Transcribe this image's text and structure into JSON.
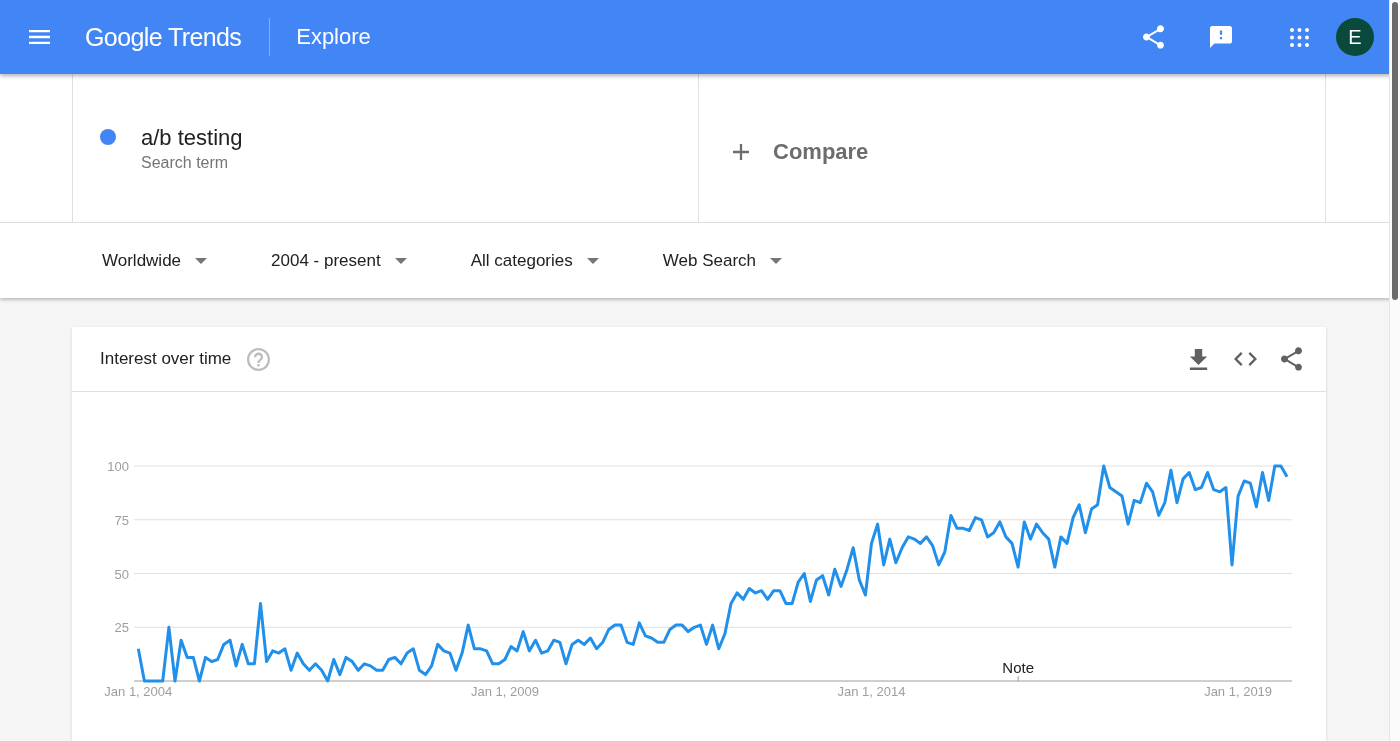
{
  "header": {
    "logo": "Google Trends",
    "page_title": "Explore",
    "avatar_initial": "E"
  },
  "search": {
    "terms": [
      {
        "term": "a/b testing",
        "caption": "Search term",
        "color": "#4285f4"
      }
    ],
    "compare_label": "Compare"
  },
  "filters": [
    "Worldwide",
    "2004 - present",
    "All categories",
    "Web Search"
  ],
  "card": {
    "title": "Interest over time",
    "chart_data": [
      {
        "type": "line",
        "x": [
          "2004-01-01",
          "2004-02-01",
          "2004-03-01",
          "2004-04-01",
          "2004-05-01",
          "2004-06-01",
          "2004-07-01",
          "2004-08-01",
          "2004-09-01",
          "2004-10-01",
          "2004-11-01",
          "2004-12-01",
          "2005-01-01",
          "2005-02-01",
          "2005-03-01",
          "2005-04-01",
          "2005-05-01",
          "2005-06-01",
          "2005-07-01",
          "2005-08-01",
          "2005-09-01",
          "2005-10-01",
          "2005-11-01",
          "2005-12-01",
          "2006-01-01",
          "2006-02-01",
          "2006-03-01",
          "2006-04-01",
          "2006-05-01",
          "2006-06-01",
          "2006-07-01",
          "2006-08-01",
          "2006-09-01",
          "2006-10-01",
          "2006-11-01",
          "2006-12-01",
          "2007-01-01",
          "2007-02-01",
          "2007-03-01",
          "2007-04-01",
          "2007-05-01",
          "2007-06-01",
          "2007-07-01",
          "2007-08-01",
          "2007-09-01",
          "2007-10-01",
          "2007-11-01",
          "2007-12-01",
          "2008-01-01",
          "2008-02-01",
          "2008-03-01",
          "2008-04-01",
          "2008-05-01",
          "2008-06-01",
          "2008-07-01",
          "2008-08-01",
          "2008-09-01",
          "2008-10-01",
          "2008-11-01",
          "2008-12-01",
          "2009-01-01",
          "2009-02-01",
          "2009-03-01",
          "2009-04-01",
          "2009-05-01",
          "2009-06-01",
          "2009-07-01",
          "2009-08-01",
          "2009-09-01",
          "2009-10-01",
          "2009-11-01",
          "2009-12-01",
          "2010-01-01",
          "2010-02-01",
          "2010-03-01",
          "2010-04-01",
          "2010-05-01",
          "2010-06-01",
          "2010-07-01",
          "2010-08-01",
          "2010-09-01",
          "2010-10-01",
          "2010-11-01",
          "2010-12-01",
          "2011-01-01",
          "2011-02-01",
          "2011-03-01",
          "2011-04-01",
          "2011-05-01",
          "2011-06-01",
          "2011-07-01",
          "2011-08-01",
          "2011-09-01",
          "2011-10-01",
          "2011-11-01",
          "2011-12-01",
          "2012-01-01",
          "2012-02-01",
          "2012-03-01",
          "2012-04-01",
          "2012-05-01",
          "2012-06-01",
          "2012-07-01",
          "2012-08-01",
          "2012-09-01",
          "2012-10-01",
          "2012-11-01",
          "2012-12-01",
          "2013-01-01",
          "2013-02-01",
          "2013-03-01",
          "2013-04-01",
          "2013-05-01",
          "2013-06-01",
          "2013-07-01",
          "2013-08-01",
          "2013-09-01",
          "2013-10-01",
          "2013-11-01",
          "2013-12-01",
          "2014-01-01",
          "2014-02-01",
          "2014-03-01",
          "2014-04-01",
          "2014-05-01",
          "2014-06-01",
          "2014-07-01",
          "2014-08-01",
          "2014-09-01",
          "2014-10-01",
          "2014-11-01",
          "2014-12-01",
          "2015-01-01",
          "2015-02-01",
          "2015-03-01",
          "2015-04-01",
          "2015-05-01",
          "2015-06-01",
          "2015-07-01",
          "2015-08-01",
          "2015-09-01",
          "2015-10-01",
          "2015-11-01",
          "2015-12-01",
          "2016-01-01",
          "2016-02-01",
          "2016-03-01",
          "2016-04-01",
          "2016-05-01",
          "2016-06-01",
          "2016-07-01",
          "2016-08-01",
          "2016-09-01",
          "2016-10-01",
          "2016-11-01",
          "2016-12-01",
          "2017-01-01",
          "2017-02-01",
          "2017-03-01",
          "2017-04-01",
          "2017-05-01",
          "2017-06-01",
          "2017-07-01",
          "2017-08-01",
          "2017-09-01",
          "2017-10-01",
          "2017-11-01",
          "2017-12-01",
          "2018-01-01",
          "2018-02-01",
          "2018-03-01",
          "2018-04-01",
          "2018-05-01",
          "2018-06-01",
          "2018-07-01",
          "2018-08-01",
          "2018-09-01",
          "2018-10-01",
          "2018-11-01",
          "2018-12-01",
          "2019-01-01",
          "2019-02-01",
          "2019-03-01",
          "2019-04-01",
          "2019-05-01",
          "2019-06-01",
          "2019-07-01",
          "2019-08-01",
          "2019-09-01"
        ],
        "series": [
          {
            "color": "#2090ea",
            "values": [
              15,
              0,
              0,
              0,
              0,
              25,
              0,
              19,
              11,
              11,
              0,
              11,
              9,
              10,
              17,
              19,
              7,
              17,
              8,
              8,
              36,
              9,
              14,
              13,
              15,
              5,
              13,
              8,
              5,
              8,
              5,
              0,
              10,
              3,
              11,
              9,
              5,
              8,
              7,
              5,
              5,
              10,
              11,
              8,
              13,
              15,
              5,
              3,
              7,
              17,
              14,
              13,
              5,
              13,
              26,
              15,
              15,
              14,
              8,
              8,
              10,
              16,
              14,
              23,
              14,
              19,
              13,
              14,
              19,
              18,
              8,
              17,
              19,
              17,
              20,
              15,
              18,
              24,
              26,
              26,
              18,
              17,
              27,
              21,
              20,
              18,
              18,
              24,
              26,
              26,
              23,
              25,
              26,
              17,
              26,
              15,
              22,
              36,
              41,
              38,
              43,
              41,
              42,
              38,
              42,
              42,
              36,
              36,
              46,
              50,
              37,
              47,
              49,
              40,
              52,
              44,
              52,
              62,
              47,
              40,
              64,
              73,
              54,
              66,
              55,
              62,
              67,
              66,
              64,
              67,
              63,
              54,
              60,
              77,
              71,
              71,
              70,
              76,
              75,
              67,
              69,
              74,
              67,
              64,
              53,
              74,
              66,
              73,
              69,
              66,
              53,
              67,
              64,
              76,
              82,
              69,
              80,
              82,
              100,
              90,
              88,
              86,
              73,
              84,
              83,
              92,
              88,
              77,
              83,
              98,
              83,
              94,
              97,
              89,
              90,
              97,
              89,
              88,
              90,
              54,
              86,
              93,
              92,
              81,
              97,
              84,
              100,
              100,
              95
            ]
          }
        ],
        "xlim": [
          "2003-12-10",
          "2019-09-26"
        ],
        "ylim": [
          0,
          100
        ],
        "yticks": [
          25,
          50,
          75,
          100
        ],
        "xticks": [
          {
            "value": "2004-01-01",
            "label": "Jan 1, 2004"
          },
          {
            "value": "2009-01-01",
            "label": "Jan 1, 2009"
          },
          {
            "value": "2014-01-01",
            "label": "Jan 1, 2014"
          },
          {
            "value": "2019-01-01",
            "label": "Jan 1, 2019"
          }
        ],
        "grid": true,
        "annotations": [
          "Note"
        ]
      }
    ]
  }
}
